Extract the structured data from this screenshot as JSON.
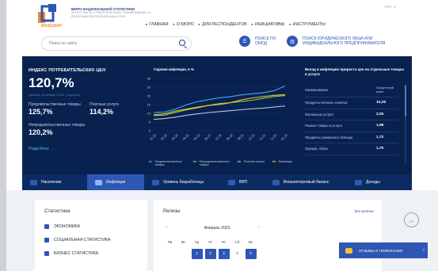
{
  "header": {
    "logo_text": "BASEMAP",
    "org_name": "БЮРО НАЦИОНАЛЬНОЙ СТАТИСТИКИ",
    "org_sub": "АГЕНТСТВА ПО СТРАТЕГИЧЕСКОМУ ПЛАНИРОВАНИЮ И РЕФОРМАМ РЕСПУБЛИКИ КАЗАХСТАН",
    "lang": "РУС",
    "nav": [
      "ГЛАВНАЯ",
      "О БЮРО",
      "ДЛЯ РЕСПОНДЕНТОВ",
      "ИНИЦИАТИВЫ",
      "ИНСТРУМЕНТЫ"
    ]
  },
  "search": {
    "placeholder": "Поиск по сайту",
    "okud_label": "ПОИСК ПО ОКЮД",
    "legal_label": "ПОИСК ЮРИДИЧЕСКОГО ЛИЦА ИЛИ ИНДИВИДУАЛЬНОГО ПРЕДПРИНИМАТЕЛЯ"
  },
  "cpi": {
    "title": "ИНДЕКС ПОТРЕБИТЕЛЬСКИХ ЦЕН",
    "value": "120,7%",
    "note": "Данные на январь 2023г. (годовые)",
    "food_label": "Продовольственные товары",
    "food_value": "125,7%",
    "services_label": "Платные услуги",
    "services_value": "114,2%",
    "nonfood_label": "Непродовольственные товары",
    "nonfood_value": "120,2%",
    "more_link": "Подробнее"
  },
  "chart_data": {
    "type": "line",
    "title": "Годовая инфляция, в %",
    "x": [
      "01.22",
      "02.22",
      "03.22",
      "04.22",
      "05.22",
      "06.22",
      "07.22",
      "08.22",
      "09.22",
      "10.22",
      "11.22",
      "12.22",
      "01.23"
    ],
    "ylim": [
      0,
      30
    ],
    "yticks": [
      0,
      5,
      10,
      15,
      20,
      25,
      30
    ],
    "series": [
      {
        "name": "Продовольственные товары",
        "color": "#3fa9f5",
        "values": [
          10.5,
          10.8,
          12.5,
          14.9,
          16.7,
          17.8,
          18.9,
          19.5,
          20.6,
          21.2,
          21.8,
          23.0,
          25.7
        ]
      },
      {
        "name": "Непродовольственные товары",
        "color": "#8fd14f",
        "values": [
          9.2,
          9.8,
          11.4,
          12.5,
          13.6,
          14.5,
          15.6,
          16.1,
          16.8,
          17.5,
          18.6,
          19.6,
          20.2
        ]
      },
      {
        "name": "Платные услуги",
        "color": "#b5c7e6",
        "values": [
          6.5,
          7.0,
          7.8,
          8.9,
          9.7,
          10.4,
          11.0,
          11.5,
          12.1,
          12.6,
          13.0,
          13.6,
          14.2
        ]
      },
      {
        "name": "Инфляция",
        "color": "#f2c230",
        "values": [
          8.7,
          9.0,
          10.6,
          12.0,
          13.2,
          14.5,
          15.0,
          16.1,
          17.7,
          18.8,
          19.6,
          20.3,
          20.7
        ]
      }
    ],
    "legend": [
      "Продовольственные товары",
      "Непродовольственные товары",
      "Платные услуги",
      "Инфляция"
    ]
  },
  "contribution": {
    "title": "Вклад в инфляцию прироста цен на отдельные товары и услуги",
    "head_name": "Наименование",
    "head_value": "Процентный пункт",
    "rows": [
      {
        "name": "Продукты питания, напитки",
        "value": "10,25"
      },
      {
        "name": "Жилищные услуги",
        "value": "2,05"
      },
      {
        "name": "Разные товары и услуги",
        "value": "1,98"
      },
      {
        "name": "Предметы домашнего обихода",
        "value": "1,72"
      },
      {
        "name": "Одежда, обувь",
        "value": "1,70"
      }
    ]
  },
  "tabs": [
    "Население",
    "Инфляция",
    "Уровень безработицы",
    "ВВП",
    "Внешнеторговый баланс",
    "Доходы"
  ],
  "statistics": {
    "title": "Статистика",
    "items": [
      "ЭКОНОМИКА",
      "СОЦИАЛЬНАЯ СТАТИСТИКА",
      "БИЗНЕС СТАТИСТИКА"
    ]
  },
  "releases": {
    "title": "Релизы",
    "all_link": "Все релизы",
    "month": "Февраль 2023",
    "days": [
      "Пн",
      "Вт",
      "Ср",
      "Чт",
      "Пт",
      "Сб",
      "Вс"
    ],
    "dates": [
      "",
      "",
      "1",
      "2",
      "3",
      "4",
      "5"
    ]
  },
  "feedback_label": "ОТЗЫВЫ И ПОЖЕЛАНИЯ"
}
